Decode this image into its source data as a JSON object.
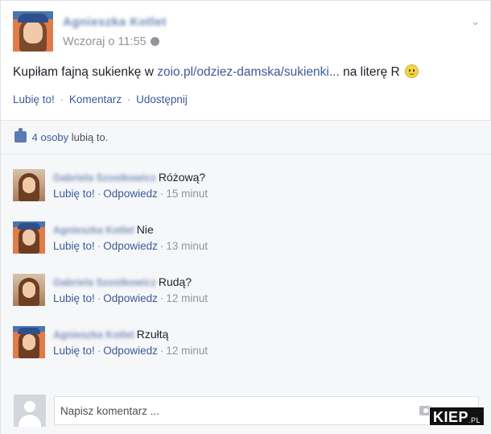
{
  "post": {
    "author": "Agnieszka Kotlet",
    "time": "Wczoraj o 11:55",
    "text_before": "Kupiłam fajną sukienkę w ",
    "link": "zoio.pl/odziez-damska/sukienki...",
    "text_after": " na literę R ",
    "actions": {
      "like": "Lubię to!",
      "comment": "Komentarz",
      "share": "Udostępnij",
      "sep": "·"
    }
  },
  "likes": {
    "count": "4 osoby",
    "suffix": " lubią to."
  },
  "comments": [
    {
      "author": "Gabriela Szostkowicz",
      "text": "Różową?",
      "like": "Lubię to!",
      "reply": "Odpowiedz",
      "time": "15 minut",
      "avatar": "girl1"
    },
    {
      "author": "Agnieszka Kotlet",
      "text": "Nie",
      "like": "Lubię to!",
      "reply": "Odpowiedz",
      "time": "13 minut",
      "avatar": "girl2"
    },
    {
      "author": "Gabriela Szostkowicz",
      "text": "Rudą?",
      "like": "Lubię to!",
      "reply": "Odpowiedz",
      "time": "12 minut",
      "avatar": "girl1"
    },
    {
      "author": "Agnieszka Kotlet",
      "text": "Rzułtą",
      "like": "Lubię to!",
      "reply": "Odpowiedz",
      "time": "12 minut",
      "avatar": "girl2"
    }
  ],
  "compose": {
    "placeholder": "Napisz komentarz ..."
  },
  "watermark": {
    "brand": "KIEP",
    "suffix": ".PL"
  },
  "colors": {
    "link": "#3b5998",
    "muted": "#90949c",
    "panel": "#f6f7f9"
  }
}
